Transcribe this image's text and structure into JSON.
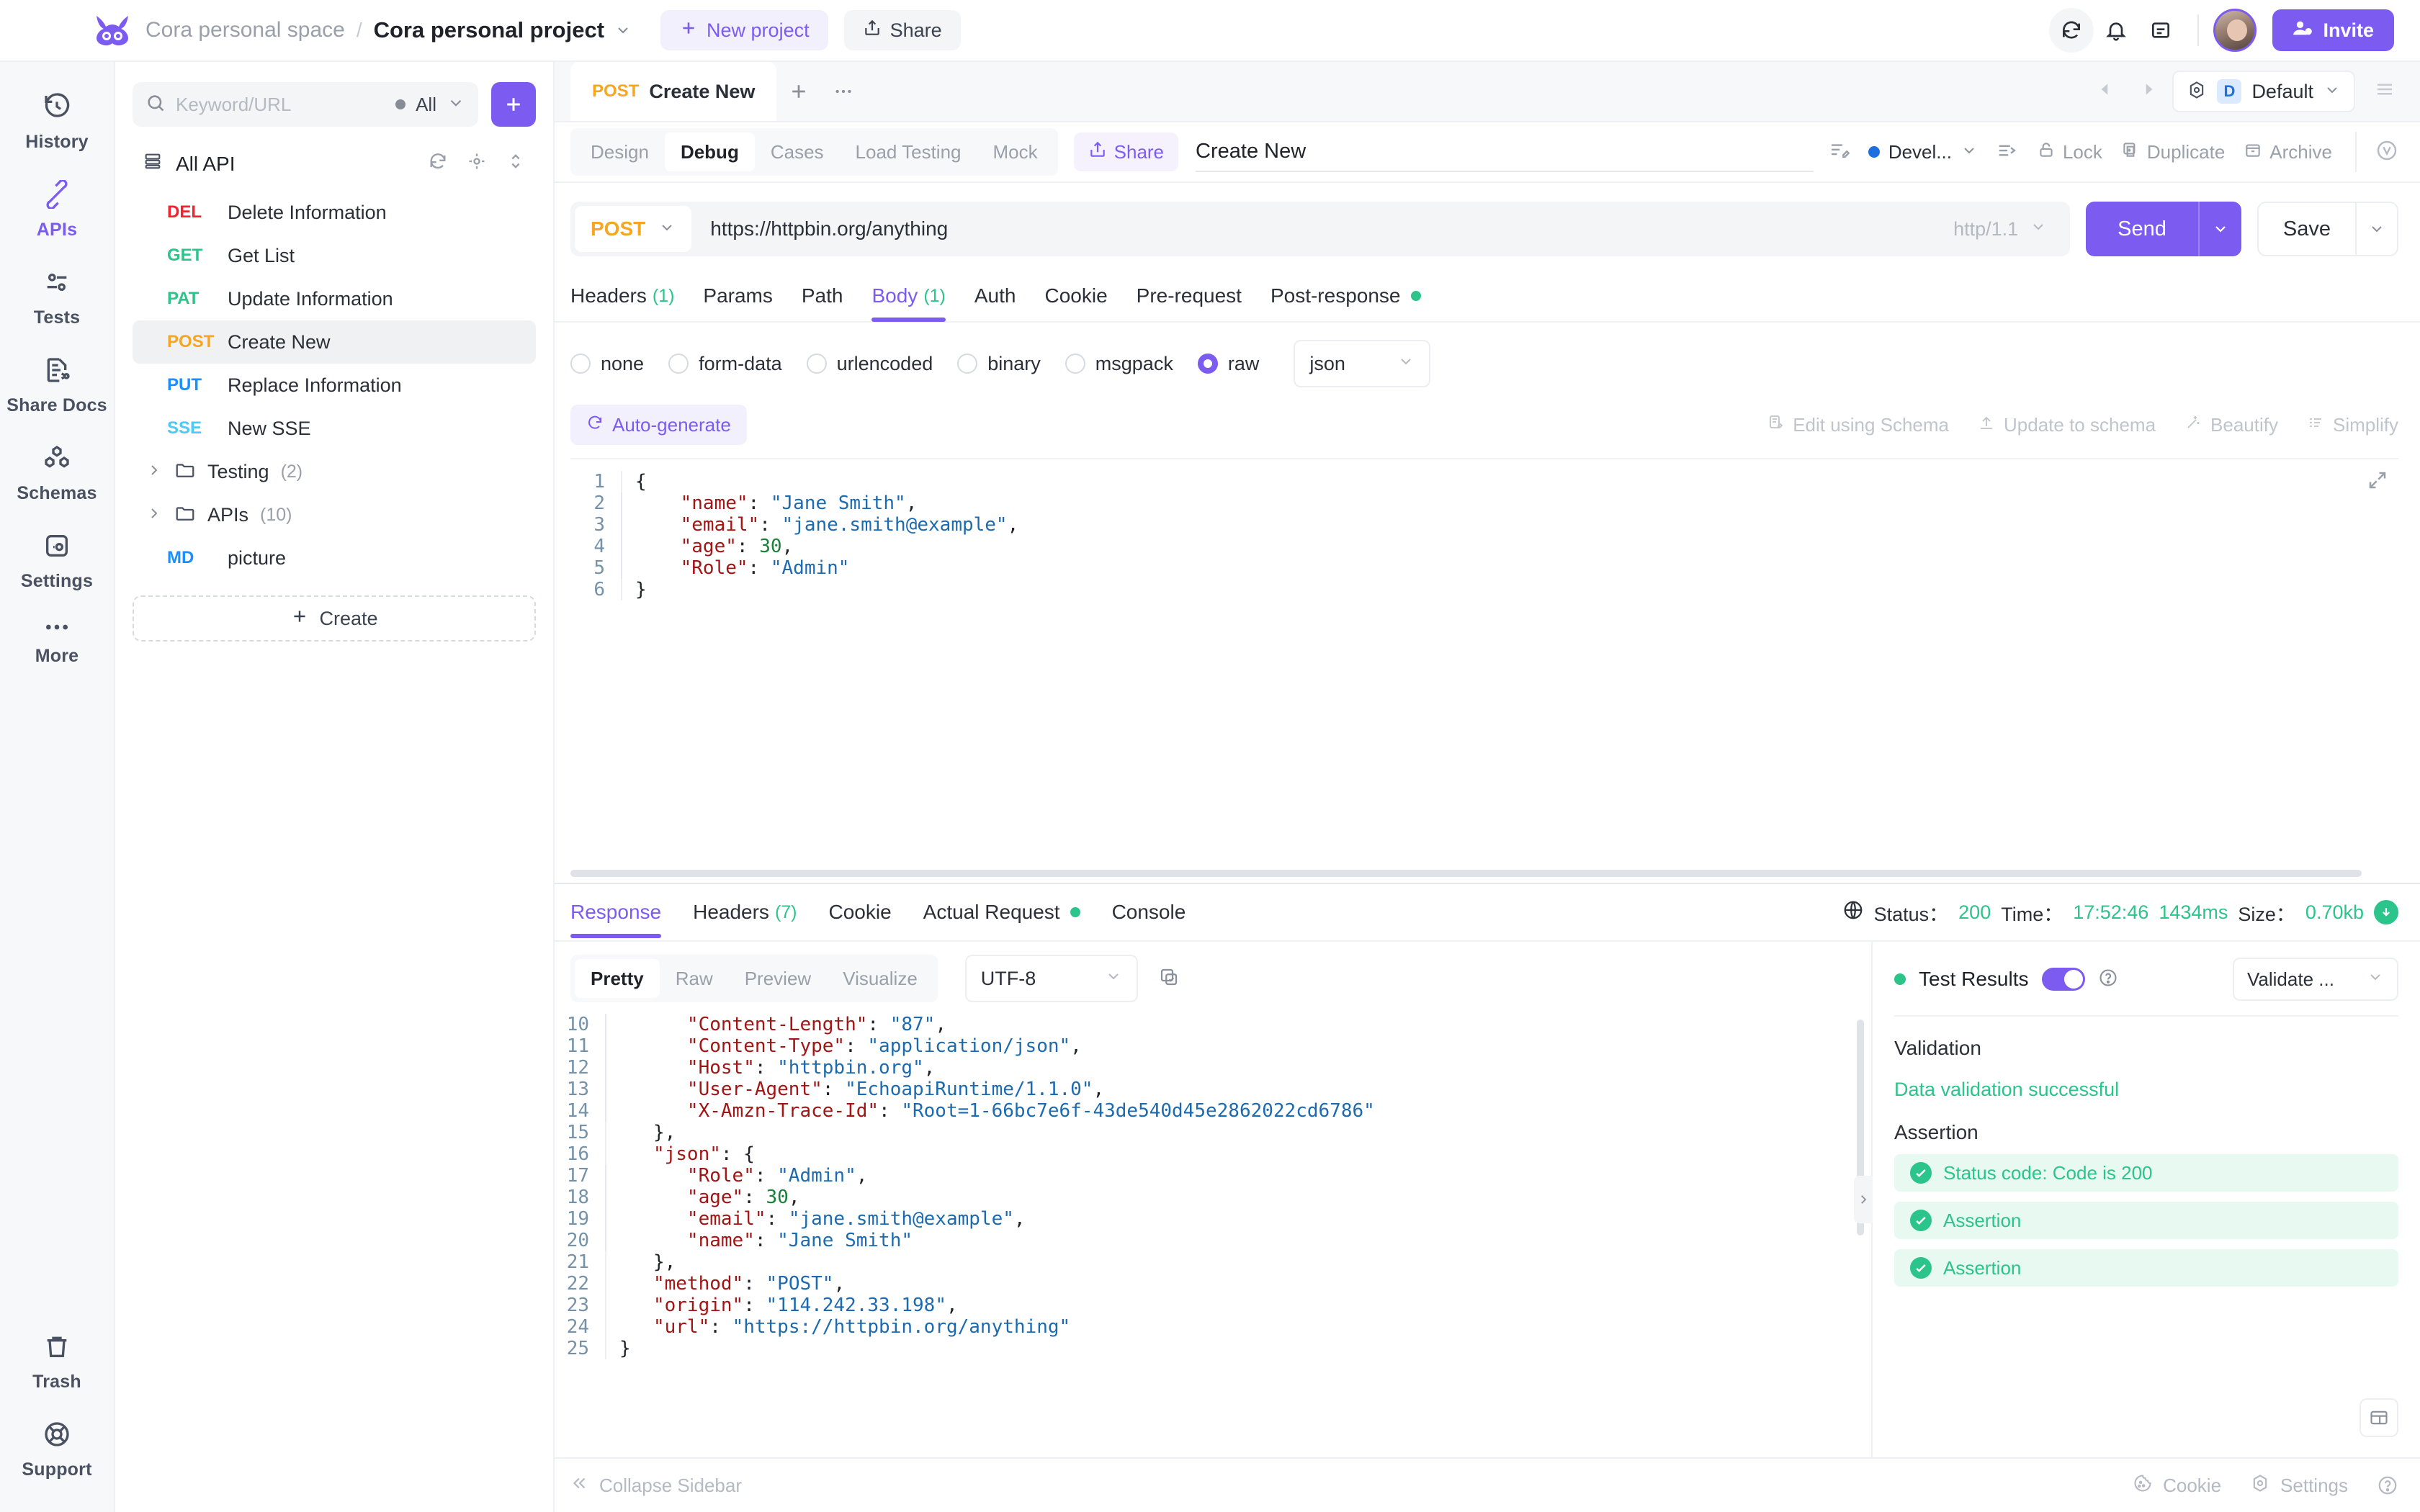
{
  "header": {
    "space": "Cora personal space",
    "separator": "/",
    "project": "Cora personal project",
    "new_project": "New project",
    "share": "Share",
    "invite": "Invite"
  },
  "rail": {
    "items": [
      {
        "label": "History",
        "icon": "history-icon"
      },
      {
        "label": "APIs",
        "icon": "apis-icon"
      },
      {
        "label": "Tests",
        "icon": "tests-icon"
      },
      {
        "label": "Share Docs",
        "icon": "share-docs-icon"
      },
      {
        "label": "Schemas",
        "icon": "schemas-icon"
      },
      {
        "label": "Settings",
        "icon": "settings-icon"
      },
      {
        "label": "More",
        "icon": "more-icon"
      }
    ],
    "bottom": [
      {
        "label": "Trash",
        "icon": "trash-icon"
      },
      {
        "label": "Support",
        "icon": "support-icon"
      }
    ]
  },
  "apilist": {
    "search_placeholder": "Keyword/URL",
    "filter_label": "All",
    "add_label": "+",
    "group_title": "All API",
    "items": [
      {
        "method": "DEL",
        "name": "Delete Information",
        "cls": "m-del"
      },
      {
        "method": "GET",
        "name": "Get List",
        "cls": "m-get"
      },
      {
        "method": "PAT",
        "name": "Update Information",
        "cls": "m-pat"
      },
      {
        "method": "POST",
        "name": "Create New",
        "cls": "m-post"
      },
      {
        "method": "PUT",
        "name": "Replace Information",
        "cls": "m-put"
      },
      {
        "method": "SSE",
        "name": "New SSE",
        "cls": "m-sse"
      }
    ],
    "folders": [
      {
        "name": "Testing",
        "count": "(2)"
      },
      {
        "name": "APIs",
        "count": "(10)"
      }
    ],
    "doc_item": {
      "method": "MD",
      "name": "picture"
    },
    "create_label": "Create"
  },
  "tabstrip": {
    "doc_method": "POST",
    "doc_name": "Create New",
    "env_badge": "D",
    "env_name": "Default"
  },
  "subbar": {
    "segments": [
      "Design",
      "Debug",
      "Cases",
      "Load Testing",
      "Mock"
    ],
    "active_segment": "Debug",
    "share_label": "Share",
    "api_name": "Create New",
    "environment": "Devel...",
    "tools": [
      "Lock",
      "Duplicate",
      "Archive"
    ]
  },
  "urlbar": {
    "method": "POST",
    "url": "https://httpbin.org/anything",
    "http_version": "http/1.1",
    "send_label": "Send",
    "save_label": "Save"
  },
  "request_tabs": [
    {
      "label": "Headers",
      "count": "(1)",
      "active": false,
      "dot": false
    },
    {
      "label": "Params",
      "count": "",
      "active": false,
      "dot": false
    },
    {
      "label": "Path",
      "count": "",
      "active": false,
      "dot": false
    },
    {
      "label": "Body",
      "count": "(1)",
      "active": true,
      "dot": false
    },
    {
      "label": "Auth",
      "count": "",
      "active": false,
      "dot": false
    },
    {
      "label": "Cookie",
      "count": "",
      "active": false,
      "dot": false
    },
    {
      "label": "Pre-request",
      "count": "",
      "active": false,
      "dot": false
    },
    {
      "label": "Post-response",
      "count": "",
      "active": false,
      "dot": true
    }
  ],
  "body": {
    "types": [
      "none",
      "form-data",
      "urlencoded",
      "binary",
      "msgpack",
      "raw"
    ],
    "selected_type": "raw",
    "format": "json",
    "autogenerate": "Auto-generate",
    "editor_actions": [
      "Edit using Schema",
      "Update to schema",
      "Beautify",
      "Simplify"
    ],
    "code_lines": [
      {
        "n": "1",
        "indent": false,
        "html": "{"
      },
      {
        "n": "2",
        "indent": true,
        "html": "    <span class=\"k\">\"name\"</span><span class=\"p\">: </span><span class=\"s\">\"Jane Smith\"</span><span class=\"p\">,</span>"
      },
      {
        "n": "3",
        "indent": true,
        "html": "    <span class=\"k\">\"email\"</span><span class=\"p\">: </span><span class=\"s\">\"jane.smith@example\"</span><span class=\"p\">,</span>"
      },
      {
        "n": "4",
        "indent": true,
        "html": "    <span class=\"k\">\"age\"</span><span class=\"p\">: </span><span class=\"n\">30</span><span class=\"p\">,</span>"
      },
      {
        "n": "5",
        "indent": true,
        "html": "    <span class=\"k\">\"Role\"</span><span class=\"p\">: </span><span class=\"s\">\"Admin\"</span>"
      },
      {
        "n": "6",
        "indent": false,
        "html": "}"
      }
    ]
  },
  "response": {
    "tabs": [
      {
        "label": "Response",
        "count": "",
        "active": true,
        "dot": false
      },
      {
        "label": "Headers",
        "count": "(7)",
        "active": false,
        "dot": false
      },
      {
        "label": "Cookie",
        "count": "",
        "active": false,
        "dot": false
      },
      {
        "label": "Actual Request",
        "count": "",
        "active": false,
        "dot": true
      },
      {
        "label": "Console",
        "count": "",
        "active": false,
        "dot": false
      }
    ],
    "status_label": "Status：",
    "status_value": "200",
    "time_label": "Time：",
    "time_value": "17:52:46",
    "duration": "1434ms",
    "size_label": "Size：",
    "size_value": "0.70kb",
    "view_modes": [
      "Pretty",
      "Raw",
      "Preview",
      "Visualize"
    ],
    "active_view": "Pretty",
    "encoding": "UTF-8",
    "code_lines": [
      {
        "n": "10",
        "indent": true,
        "html": "      <span class=\"k\">\"Content-Length\"</span><span class=\"p\">: </span><span class=\"s\">\"87\"</span><span class=\"p\">,</span>"
      },
      {
        "n": "11",
        "indent": true,
        "html": "      <span class=\"k\">\"Content-Type\"</span><span class=\"p\">: </span><span class=\"s\">\"application/json\"</span><span class=\"p\">,</span>"
      },
      {
        "n": "12",
        "indent": true,
        "html": "      <span class=\"k\">\"Host\"</span><span class=\"p\">: </span><span class=\"s\">\"httpbin.org\"</span><span class=\"p\">,</span>"
      },
      {
        "n": "13",
        "indent": true,
        "html": "      <span class=\"k\">\"User-Agent\"</span><span class=\"p\">: </span><span class=\"s\">\"EchoapiRuntime/1.1.0\"</span><span class=\"p\">,</span>"
      },
      {
        "n": "14",
        "indent": true,
        "html": "      <span class=\"k\">\"X-Amzn-Trace-Id\"</span><span class=\"p\">: </span><span class=\"s\">\"Root=1-66bc7e6f-43de540d45e2862022cd6786\"</span>"
      },
      {
        "n": "15",
        "indent": false,
        "html": "   <span class=\"p\">},</span>"
      },
      {
        "n": "16",
        "indent": false,
        "html": "   <span class=\"k\">\"json\"</span><span class=\"p\">: {</span>"
      },
      {
        "n": "17",
        "indent": true,
        "html": "      <span class=\"k\">\"Role\"</span><span class=\"p\">: </span><span class=\"s\">\"Admin\"</span><span class=\"p\">,</span>"
      },
      {
        "n": "18",
        "indent": true,
        "html": "      <span class=\"k\">\"age\"</span><span class=\"p\">: </span><span class=\"n\">30</span><span class=\"p\">,</span>"
      },
      {
        "n": "19",
        "indent": true,
        "html": "      <span class=\"k\">\"email\"</span><span class=\"p\">: </span><span class=\"s\">\"jane.smith@example\"</span><span class=\"p\">,</span>"
      },
      {
        "n": "20",
        "indent": true,
        "html": "      <span class=\"k\">\"name\"</span><span class=\"p\">: </span><span class=\"s\">\"Jane Smith\"</span>"
      },
      {
        "n": "21",
        "indent": false,
        "html": "   <span class=\"p\">},</span>"
      },
      {
        "n": "22",
        "indent": false,
        "html": "   <span class=\"k\">\"method\"</span><span class=\"p\">: </span><span class=\"s\">\"POST\"</span><span class=\"p\">,</span>"
      },
      {
        "n": "23",
        "indent": false,
        "html": "   <span class=\"k\">\"origin\"</span><span class=\"p\">: </span><span class=\"s\">\"114.242.33.198\"</span><span class=\"p\">,</span>"
      },
      {
        "n": "24",
        "indent": false,
        "html": "   <span class=\"k\">\"url\"</span><span class=\"p\">: </span><span class=\"s\">\"https://httpbin.org/anything\"</span>"
      },
      {
        "n": "25",
        "indent": false,
        "html": "<span class=\"p\">}</span>"
      }
    ]
  },
  "test_results": {
    "title": "Test Results",
    "validate_select": "Validate ...",
    "validation_title": "Validation",
    "validation_message": "Data validation successful",
    "assertion_title": "Assertion",
    "assertions": [
      "Status code: Code is 200",
      "Assertion",
      "Assertion"
    ]
  },
  "footer": {
    "collapse": "Collapse Sidebar",
    "cookie": "Cookie",
    "settings": "Settings"
  },
  "colors": {
    "accent": "#7c5cf0",
    "success": "#2bc48a",
    "post": "#f5a623",
    "delete": "#f5222d",
    "put": "#1890ff"
  }
}
